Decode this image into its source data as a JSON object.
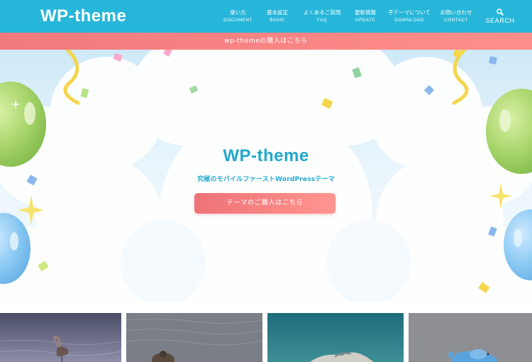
{
  "header": {
    "logo": "WP-theme",
    "nav": [
      {
        "jp": "使い方",
        "en": "DOCUMENT"
      },
      {
        "jp": "基本設定",
        "en": "BASIC"
      },
      {
        "jp": "よくあるご質問",
        "en": "FAQ"
      },
      {
        "jp": "更新情報",
        "en": "UPDATE"
      },
      {
        "jp": "子テーマについて",
        "en": "DOWNLOAD"
      },
      {
        "jp": "お問い合わせ",
        "en": "CONTACT"
      }
    ],
    "search": {
      "label": "SEARCH",
      "icon": "search-icon"
    }
  },
  "notice": {
    "text": "wp-themeの購入はこちら"
  },
  "hero": {
    "title": "WP-theme",
    "subtitle": "究極のモバイルファーストWordPressテーマ",
    "button": "テーマのご購入はこちら"
  },
  "colors": {
    "header_bg": "#26b6d9",
    "accent_coral": "#f07a7e",
    "title_blue": "#21a9cc"
  },
  "gallery": [
    {
      "subject": "flamingo-on-water"
    },
    {
      "subject": "bird-on-grey-water"
    },
    {
      "subject": "bird-on-teal-water"
    },
    {
      "subject": "blue-elephant-toy"
    }
  ]
}
